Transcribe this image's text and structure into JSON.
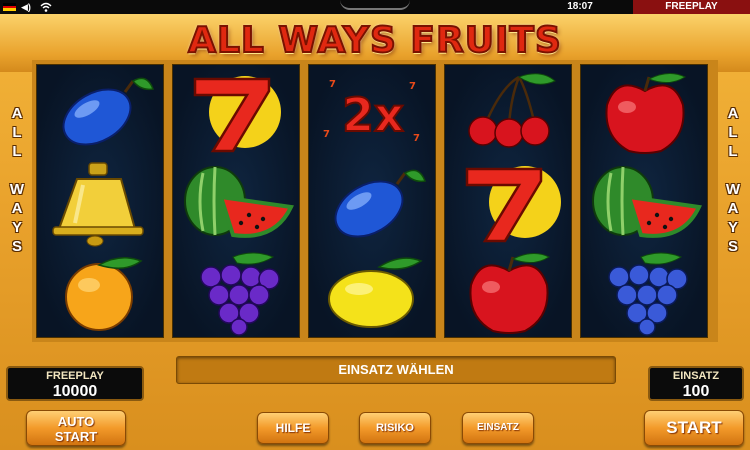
{
  "status_bar": {
    "time": "18:07",
    "mode": "FREEPLAY"
  },
  "game": {
    "title": "ALL WAYS FRUITS",
    "side_label": [
      "A",
      "L",
      "L",
      "",
      "W",
      "A",
      "Y",
      "S"
    ],
    "reels": [
      [
        "plum",
        "bell",
        "orange"
      ],
      [
        "seven",
        "watermelon",
        "grapes"
      ],
      [
        "2x",
        "plum",
        "lemon"
      ],
      [
        "cherries",
        "seven",
        "apple"
      ],
      [
        "apple",
        "watermelon",
        "grapes"
      ]
    ],
    "multiplier_text": "2x"
  },
  "controls": {
    "freeplay_label": "FREEPLAY",
    "freeplay_value": "10000",
    "message": "EINSATZ WÄHLEN",
    "einsatz_label": "EINSATZ",
    "einsatz_value": "100",
    "buttons": {
      "auto_start_line1": "AUTO",
      "auto_start_line2": "START",
      "hilfe": "HILFE",
      "risiko": "RISIKO",
      "einsatz": "EINSATZ",
      "start": "START"
    }
  },
  "colors": {
    "title": "#e02810",
    "reel_bg": "#0f2540",
    "frame": "#e9a22c",
    "mode_bar": "#8a1010"
  }
}
